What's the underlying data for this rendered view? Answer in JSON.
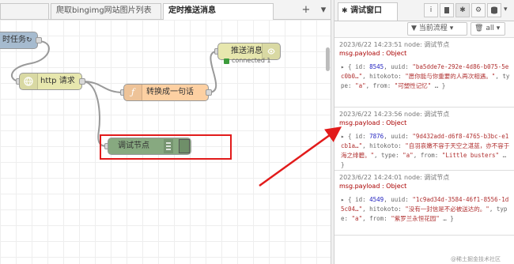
{
  "editor": {
    "tabs": [
      {
        "label": ""
      },
      {
        "label": "爬取bingimg网站图片列表"
      },
      {
        "label": "定时推送消息"
      }
    ],
    "add_tab": "+",
    "tab_menu": "▾",
    "nodes": {
      "timer": {
        "label": "时任务",
        "suffix": "↻"
      },
      "http": {
        "label": "http 请求"
      },
      "func": {
        "label": "转换成一句话"
      },
      "push": {
        "label": "推送消息",
        "status": "connected 1"
      },
      "debug": {
        "label": "调试节点"
      }
    }
  },
  "debug_panel": {
    "tab_label": "调试窗口",
    "toolbar": {
      "filter_label": "当前流程",
      "clear_label": "all"
    },
    "messages": [
      {
        "meta": "2023/6/22 14:23:51   node: 调试节点",
        "topic": "msg.payload : Object",
        "id": "8545",
        "uuid": "\"ba5dde7e-292e-4d86-b075-5ec0b0…\"",
        "hitokoto": "\"愿你能与你重要的人再次相遇。\"",
        "type": "\"a\"",
        "from": "\"可塑性记忆\"",
        "tail": "… }"
      },
      {
        "meta": "2023/6/22 14:23:56   node: 调试节点",
        "topic": "msg.payload : Object",
        "id": "7876",
        "uuid": "\"9d432add-d6f8-4765-b3bc-e1cb1a…\"",
        "hitokoto": "\"自羽哀嫩不容于天空之湛蓝，亦不容于海之绯碧。\"",
        "type": "\"a\"",
        "from": "\"Little busters\"",
        "tail": "… }"
      },
      {
        "meta": "2023/6/22 14:24:01   node: 调试节点",
        "topic": "msg.payload : Object",
        "id": "4549",
        "uuid": "\"1c9ad34d-3584-46f1-8556-1d5c04…\"",
        "hitokoto": "\"没有一封信是不必被送达的。\"",
        "type": "\"a\"",
        "from": "\"紫罗兰永恒花园\"",
        "tail": "… }"
      }
    ]
  },
  "watermark": "@稀土掘金技术社区",
  "colors": {
    "timer_node": "#a6bbcf",
    "http_node": "#e7e7ae",
    "function_node": "#fdd0a2",
    "push_node": "#e7e7ae",
    "debug_node": "#87a980",
    "status_green": "#3c9b3c",
    "highlight": "#e21b1b",
    "arrow": "#e21b1b"
  }
}
